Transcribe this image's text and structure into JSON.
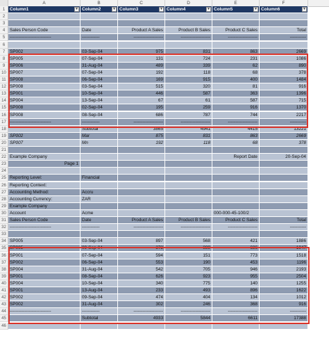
{
  "columns": [
    "A",
    "B",
    "C",
    "D",
    "E",
    "F"
  ],
  "rows": [
    {
      "n": "1",
      "style": "h",
      "cells": [
        "Column1",
        "Column2",
        "Column3",
        "Column4",
        "Column5",
        "Column6"
      ]
    },
    {
      "n": "2",
      "style": "a",
      "cells": [
        "",
        "",
        "",
        "",
        "",
        ""
      ]
    },
    {
      "n": "3",
      "style": "b",
      "cells": [
        "",
        "",
        "",
        "",
        "",
        ""
      ]
    },
    {
      "n": "4",
      "style": "a",
      "cells": [
        "Sales Person Code",
        "Date",
        "Product A Sales",
        "Product B Sales",
        "Product C Sales",
        "Total"
      ]
    },
    {
      "n": "5",
      "style": "b",
      "cells": [
        "----------------------------",
        "------------",
        "--------------------",
        "--------------------",
        "--------------------",
        "-----------"
      ]
    },
    {
      "n": "6",
      "style": "a",
      "cells": [
        "",
        "",
        "",
        "",
        "",
        ""
      ]
    },
    {
      "n": "7",
      "style": "b",
      "cells": [
        "SP002",
        "03-Sep-04",
        "975",
        "831",
        "863",
        "2669"
      ]
    },
    {
      "n": "8",
      "style": "a",
      "cells": [
        "SP005",
        "07-Sep-04",
        "131",
        "724",
        "231",
        "1086"
      ]
    },
    {
      "n": "9",
      "style": "b",
      "cells": [
        "SP006",
        "31-Aug-04",
        "489",
        "339",
        "62",
        "890"
      ]
    },
    {
      "n": "10",
      "style": "a",
      "cells": [
        "SP007",
        "07-Sep-04",
        "192",
        "118",
        "68",
        "378"
      ]
    },
    {
      "n": "11",
      "style": "b",
      "cells": [
        "SP008",
        "06-Sep-04",
        "169",
        "915",
        "400",
        "1484"
      ]
    },
    {
      "n": "12",
      "style": "a",
      "cells": [
        "SP008",
        "03-Sep-04",
        "515",
        "320",
        "81",
        "916"
      ]
    },
    {
      "n": "13",
      "style": "b",
      "cells": [
        "SP001",
        "10-Sep-04",
        "446",
        "587",
        "363",
        "1396"
      ]
    },
    {
      "n": "14",
      "style": "a",
      "cells": [
        "SP004",
        "13-Sep-04",
        "67",
        "61",
        "587",
        "715"
      ]
    },
    {
      "n": "15",
      "style": "b",
      "cells": [
        "SP008",
        "02-Sep-04",
        "195",
        "259",
        "916",
        "1370"
      ]
    },
    {
      "n": "16",
      "style": "a",
      "cells": [
        "SP008",
        "08-Sep-04",
        "686",
        "787",
        "744",
        "2217"
      ]
    },
    {
      "n": "17",
      "style": "b",
      "cells": [
        "----------------------------",
        "------------",
        "--------------------",
        "--------------------",
        "--------------------",
        "-----------"
      ]
    },
    {
      "n": "18",
      "style": "a",
      "cells": [
        "",
        "Subtotal",
        "3865",
        "4941",
        "4415",
        "13221"
      ]
    },
    {
      "n": "19",
      "style": "b",
      "italic": true,
      "cells": [
        "SP002",
        "Mar",
        "875",
        "831",
        "863",
        "2669"
      ]
    },
    {
      "n": "20",
      "style": "a",
      "italic": true,
      "cells": [
        "SP007",
        "Mn",
        "192",
        "118",
        "68",
        "378"
      ]
    },
    {
      "n": "21",
      "style": "b",
      "cells": [
        "",
        "",
        "",
        "",
        "",
        ""
      ]
    },
    {
      "n": "22",
      "style": "a",
      "cells": [
        "Example Company",
        "",
        "",
        "",
        "Report Date",
        "20-Sep-04"
      ]
    },
    {
      "n": "23",
      "style": "b",
      "cells": [
        "Page 1",
        "",
        "",
        "",
        "",
        ""
      ]
    },
    {
      "n": "24",
      "style": "a",
      "cells": [
        "",
        "",
        "",
        "",
        "",
        ""
      ]
    },
    {
      "n": "25",
      "style": "b",
      "cells": [
        "Reporting Level:",
        "Financial",
        "",
        "",
        "",
        ""
      ]
    },
    {
      "n": "26",
      "style": "a",
      "cells": [
        "Reporting Context:",
        "",
        "",
        "",
        "",
        ""
      ]
    },
    {
      "n": "27",
      "style": "b",
      "cells": [
        "Accounting Method:",
        "Accru",
        "",
        "",
        "",
        ""
      ]
    },
    {
      "n": "28",
      "style": "a",
      "cells": [
        "Accounting Currency:",
        "ZAR",
        "",
        "",
        "",
        ""
      ]
    },
    {
      "n": "29",
      "style": "b",
      "cells": [
        "Example Company",
        "",
        "",
        "",
        "",
        ""
      ]
    },
    {
      "n": "30",
      "style": "a",
      "cells": [
        "Account",
        "Acme",
        "",
        "",
        "000-000-45-100/2",
        ""
      ]
    },
    {
      "n": "31",
      "style": "b",
      "cells": [
        "Sales Person Code",
        "Date",
        "Product A Sales",
        "Product B Sales",
        "Product C Sales",
        "Total"
      ]
    },
    {
      "n": "32",
      "style": "a",
      "cells": [
        "----------------------------",
        "------------",
        "--------------------",
        "--------------------",
        "--------------------",
        "-----------"
      ]
    },
    {
      "n": "33",
      "style": "b",
      "cells": [
        "",
        "",
        "",
        "",
        "",
        ""
      ]
    },
    {
      "n": "34",
      "style": "a",
      "cells": [
        "SP005",
        "03-Sep-04",
        "897",
        "568",
        "421",
        "1886"
      ]
    },
    {
      "n": "35",
      "style": "b",
      "cells": [
        "SP005",
        "09-Sep-04",
        "372",
        "889",
        "686",
        "1947"
      ]
    },
    {
      "n": "36",
      "style": "a",
      "cells": [
        "SP001",
        "07-Sep-04",
        "594",
        "151",
        "773",
        "1518"
      ]
    },
    {
      "n": "37",
      "style": "b",
      "cells": [
        "SP002",
        "06-Sep-04",
        "553",
        "190",
        "453",
        "1196"
      ]
    },
    {
      "n": "38",
      "style": "a",
      "cells": [
        "SP004",
        "31-Aug-04",
        "542",
        "705",
        "946",
        "2193"
      ]
    },
    {
      "n": "39",
      "style": "b",
      "cells": [
        "SP001",
        "08-Sep-04",
        "626",
        "923",
        "955",
        "2504"
      ]
    },
    {
      "n": "40",
      "style": "a",
      "cells": [
        "SP004",
        "10-Sep-04",
        "340",
        "775",
        "140",
        "1255"
      ]
    },
    {
      "n": "41",
      "style": "b",
      "cells": [
        "SP001",
        "13-Aug-04",
        "233",
        "493",
        "896",
        "1622"
      ]
    },
    {
      "n": "42",
      "style": "a",
      "cells": [
        "SP002",
        "09-Sep-04",
        "474",
        "404",
        "134",
        "1012"
      ]
    },
    {
      "n": "43",
      "style": "b",
      "cells": [
        "SP002",
        "31-Aug-04",
        "302",
        "246",
        "368",
        "916"
      ]
    },
    {
      "n": "44",
      "style": "a",
      "cells": [
        "----------------------------",
        "------------",
        "--------------------",
        "--------------------",
        "--------------------",
        "-----------"
      ]
    },
    {
      "n": "45",
      "style": "b",
      "cells": [
        "",
        "Subtotal",
        "4933",
        "5844",
        "6611",
        "17388"
      ]
    },
    {
      "n": "46",
      "style": "a",
      "cells": [
        "",
        "",
        "",
        "",
        "",
        ""
      ]
    }
  ],
  "filter_glyph": "▾",
  "colors": {
    "highlight_box": "#d9342b",
    "header_fill": "#1f3864",
    "band_light": "#b9c3d3",
    "band_dark": "#8e9bb1"
  }
}
